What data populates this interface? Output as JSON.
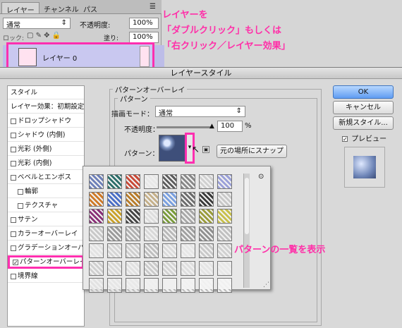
{
  "layers_panel": {
    "tabs": [
      "レイヤー",
      "チャンネル",
      "パス"
    ],
    "blend_mode": "通常",
    "opacity_label": "不透明度:",
    "opacity_value": "100%",
    "lock_label": "ロック:",
    "fill_label": "塗り:",
    "fill_value": "100%",
    "layer_name": "レイヤー 0"
  },
  "annotations": {
    "top_line1": "レイヤーを",
    "top_line2": "「ダブルクリック」もしくは",
    "top_line3": "「右クリック／レイヤー効果」",
    "pattern_note": "パターンの一覧を表示"
  },
  "dialog": {
    "title": "レイヤースタイル",
    "sidebar": [
      {
        "label": "スタイル",
        "checkbox": false,
        "checked": false,
        "indent": false,
        "header": true
      },
      {
        "label": "レイヤー効果：初期設定",
        "checkbox": false,
        "checked": false,
        "indent": false,
        "header": true
      },
      {
        "label": "ドロップシャドウ",
        "checkbox": true,
        "checked": false,
        "indent": false
      },
      {
        "label": "シャドウ (内側)",
        "checkbox": true,
        "checked": false,
        "indent": false
      },
      {
        "label": "光彩 (外側)",
        "checkbox": true,
        "checked": false,
        "indent": false
      },
      {
        "label": "光彩 (内側)",
        "checkbox": true,
        "checked": false,
        "indent": false
      },
      {
        "label": "ベベルとエンボス",
        "checkbox": true,
        "checked": false,
        "indent": false
      },
      {
        "label": "輪郭",
        "checkbox": true,
        "checked": false,
        "indent": true
      },
      {
        "label": "テクスチャ",
        "checkbox": true,
        "checked": false,
        "indent": true
      },
      {
        "label": "サテン",
        "checkbox": true,
        "checked": false,
        "indent": false
      },
      {
        "label": "カラーオーバーレイ",
        "checkbox": true,
        "checked": false,
        "indent": false
      },
      {
        "label": "グラデーションオーバーレ",
        "checkbox": true,
        "checked": false,
        "indent": false
      },
      {
        "label": "パターンオーバーレイ",
        "checkbox": true,
        "checked": true,
        "indent": false
      },
      {
        "label": "境界線",
        "checkbox": true,
        "checked": false,
        "indent": false
      }
    ],
    "section_title": "パターンオーバーレイ",
    "group_title": "パターン",
    "blend_label": "描画モード：",
    "blend_value": "通常",
    "opacity_label": "不透明度：",
    "opacity_value": "100",
    "opacity_unit": "%",
    "pattern_label": "パターン：",
    "snap_button": "元の場所にスナップ",
    "ok_button": "OK",
    "cancel_button": "キャンセル",
    "new_style_button": "新規スタイル...",
    "preview_label": "プレビュー",
    "preview_checked": true
  },
  "pattern_swatches": [
    "#6d7fb8",
    "#2d6e6a",
    "#c94a38",
    "#e8e8e8",
    "#5c5c5c",
    "#888",
    "#d0d0d0",
    "#9aa0d8",
    "#cf7a28",
    "#4a6fc7",
    "#b87c2a",
    "#c5b08a",
    "#7aa0e0",
    "#6c6c6c",
    "#3a3a3a",
    "#c8c8c8",
    "#8a2f78",
    "#c9a12a",
    "#444",
    "#ddd",
    "#7a9b3a",
    "#a8a8a8",
    "#9a9c3a",
    "#c8c04a",
    "#c8c8c8",
    "#9a9a9a",
    "#b0b0b0",
    "#d8d8d8",
    "#b8b8b8",
    "#a0a0a0",
    "#909090",
    "#c0c0c0",
    "#e2e2e2",
    "#d4d4d4",
    "#cdcdcd",
    "#bebebe",
    "#dadada",
    "#e6e6e6",
    "#c8c8c8",
    "#d0d0d0",
    "#cfcfcf",
    "#d9d9d9",
    "#e0e0e0",
    "#cacaca",
    "#d3d3d3",
    "#dedede",
    "#e4e4e4",
    "#e8e8e8",
    "#e2e2e2",
    "#e6e6e6",
    "#e9e9e9",
    "#eeeeee",
    "#f0f0f0",
    "#f2f2f2",
    "#f4f4f4",
    "#f5f5f5"
  ]
}
